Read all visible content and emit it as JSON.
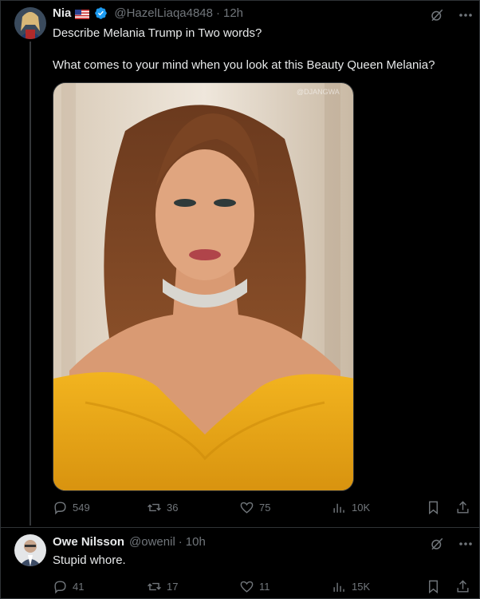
{
  "post": {
    "display_name": "Nia",
    "handle": "@HazelLiaqa4848",
    "separator": "·",
    "time": "12h",
    "text": "Describe Melania Trump in Two words?\n\nWhat comes to your mind when you look at this Beauty Queen Melania?",
    "watermark": "@DJANGWA",
    "stats": {
      "replies": "549",
      "reposts": "36",
      "likes": "75",
      "views": "10K"
    }
  },
  "reply": {
    "display_name": "Owe Nilsson",
    "handle": "@owenil",
    "separator": "·",
    "time": "10h",
    "text": "Stupid whore.",
    "stats": {
      "replies": "41",
      "reposts": "17",
      "likes": "11",
      "views": "15K"
    }
  },
  "colors": {
    "background": "#000000",
    "text": "#e7e9ea",
    "muted": "#71767b",
    "verified": "#1d9bf0",
    "border": "#2f3336"
  },
  "icons": [
    "grok-icon",
    "more-icon",
    "reply-icon",
    "repost-icon",
    "like-icon",
    "views-icon",
    "bookmark-icon",
    "share-icon",
    "verified-badge-icon",
    "us-flag-icon"
  ]
}
